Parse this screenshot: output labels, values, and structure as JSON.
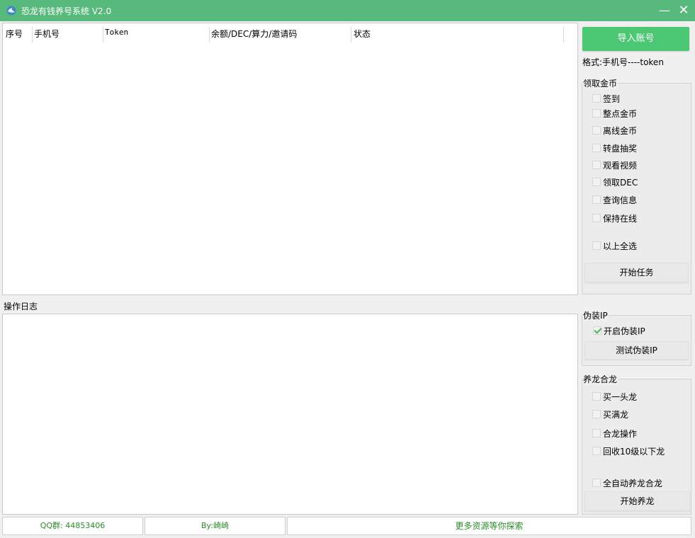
{
  "window": {
    "title": "恐龙有钱养号系统 V2.0",
    "minimize_symbol": "—",
    "close_symbol": "✕",
    "titlebar_color": "#57b97b"
  },
  "accounts_table": {
    "columns": [
      "序号",
      "手机号",
      "Token",
      "余额/DEC/算力/邀请码",
      "状态"
    ],
    "rows": []
  },
  "log": {
    "label": "操作日志",
    "entries": []
  },
  "import": {
    "button_label": "导入账号",
    "format_hint": "格式:手机号----token",
    "button_color": "#4cc774"
  },
  "coins_group": {
    "title": "领取金币",
    "options": [
      {
        "label": "签到",
        "checked": false
      },
      {
        "label": "整点金币",
        "checked": false
      },
      {
        "label": "离线金币",
        "checked": false
      },
      {
        "label": "转盘抽奖",
        "checked": false
      },
      {
        "label": "观看视频",
        "checked": false
      },
      {
        "label": "领取DEC",
        "checked": false
      },
      {
        "label": "查询信息",
        "checked": false
      },
      {
        "label": "保持在线",
        "checked": false
      }
    ],
    "select_all": {
      "label": "以上全选",
      "checked": false
    },
    "start_button": "开始任务"
  },
  "ip_group": {
    "title": "伪装IP",
    "enable": {
      "label": "开启伪装IP",
      "checked": true
    },
    "test_button": "测试伪装IP"
  },
  "dragon_group": {
    "title": "养龙合龙",
    "options": [
      {
        "label": "买一头龙",
        "checked": false
      },
      {
        "label": "买满龙",
        "checked": false
      },
      {
        "label": "合龙操作",
        "checked": false
      },
      {
        "label": "回收10级以下龙",
        "checked": false
      }
    ],
    "auto": {
      "label": "全自动养龙合龙",
      "checked": false
    },
    "start_button": "开始养龙"
  },
  "statusbar": {
    "qq_group": "QQ群: 44853406",
    "author": "By:崎崎",
    "more_resources": "更多资源等你探索",
    "text_color": "#2d8a2d"
  }
}
